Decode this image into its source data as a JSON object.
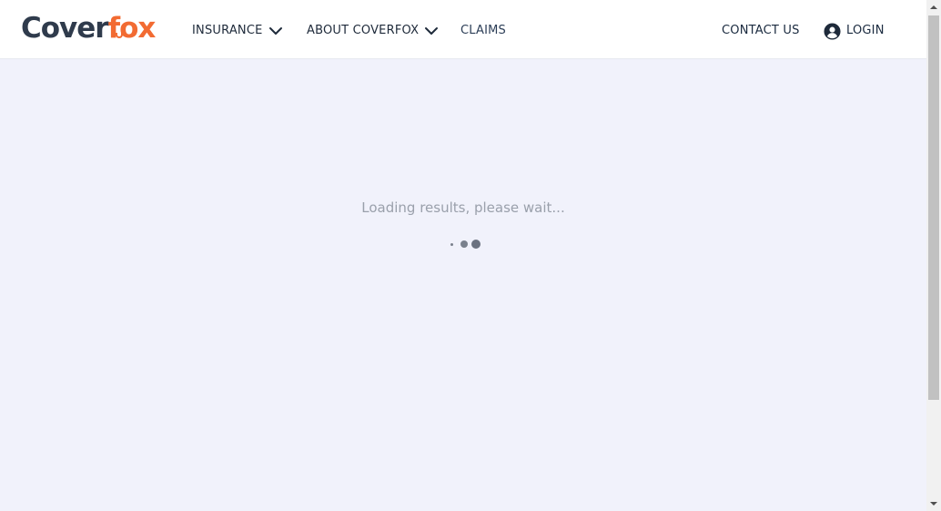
{
  "brand": {
    "logo_part1": "Cover",
    "logo_part2": "fox",
    "colors": {
      "dark": "#2f3b4c",
      "accent": "#f26b32"
    }
  },
  "nav": {
    "insurance_label": "INSURANCE",
    "about_label": "ABOUT COVERFOX",
    "claims_label": "CLAIMS",
    "contact_label": "CONTACT US",
    "login_label": "LOGIN",
    "icons": {
      "dropdown": "chevron-down-icon",
      "login": "user-circle-icon"
    }
  },
  "main": {
    "loading_text": "Loading results, please wait...",
    "spinner_icon": "loading-dots-icon"
  },
  "scrollbar": {
    "icons": {
      "up": "scroll-up-arrow-icon",
      "down": "scroll-down-arrow-icon"
    }
  }
}
